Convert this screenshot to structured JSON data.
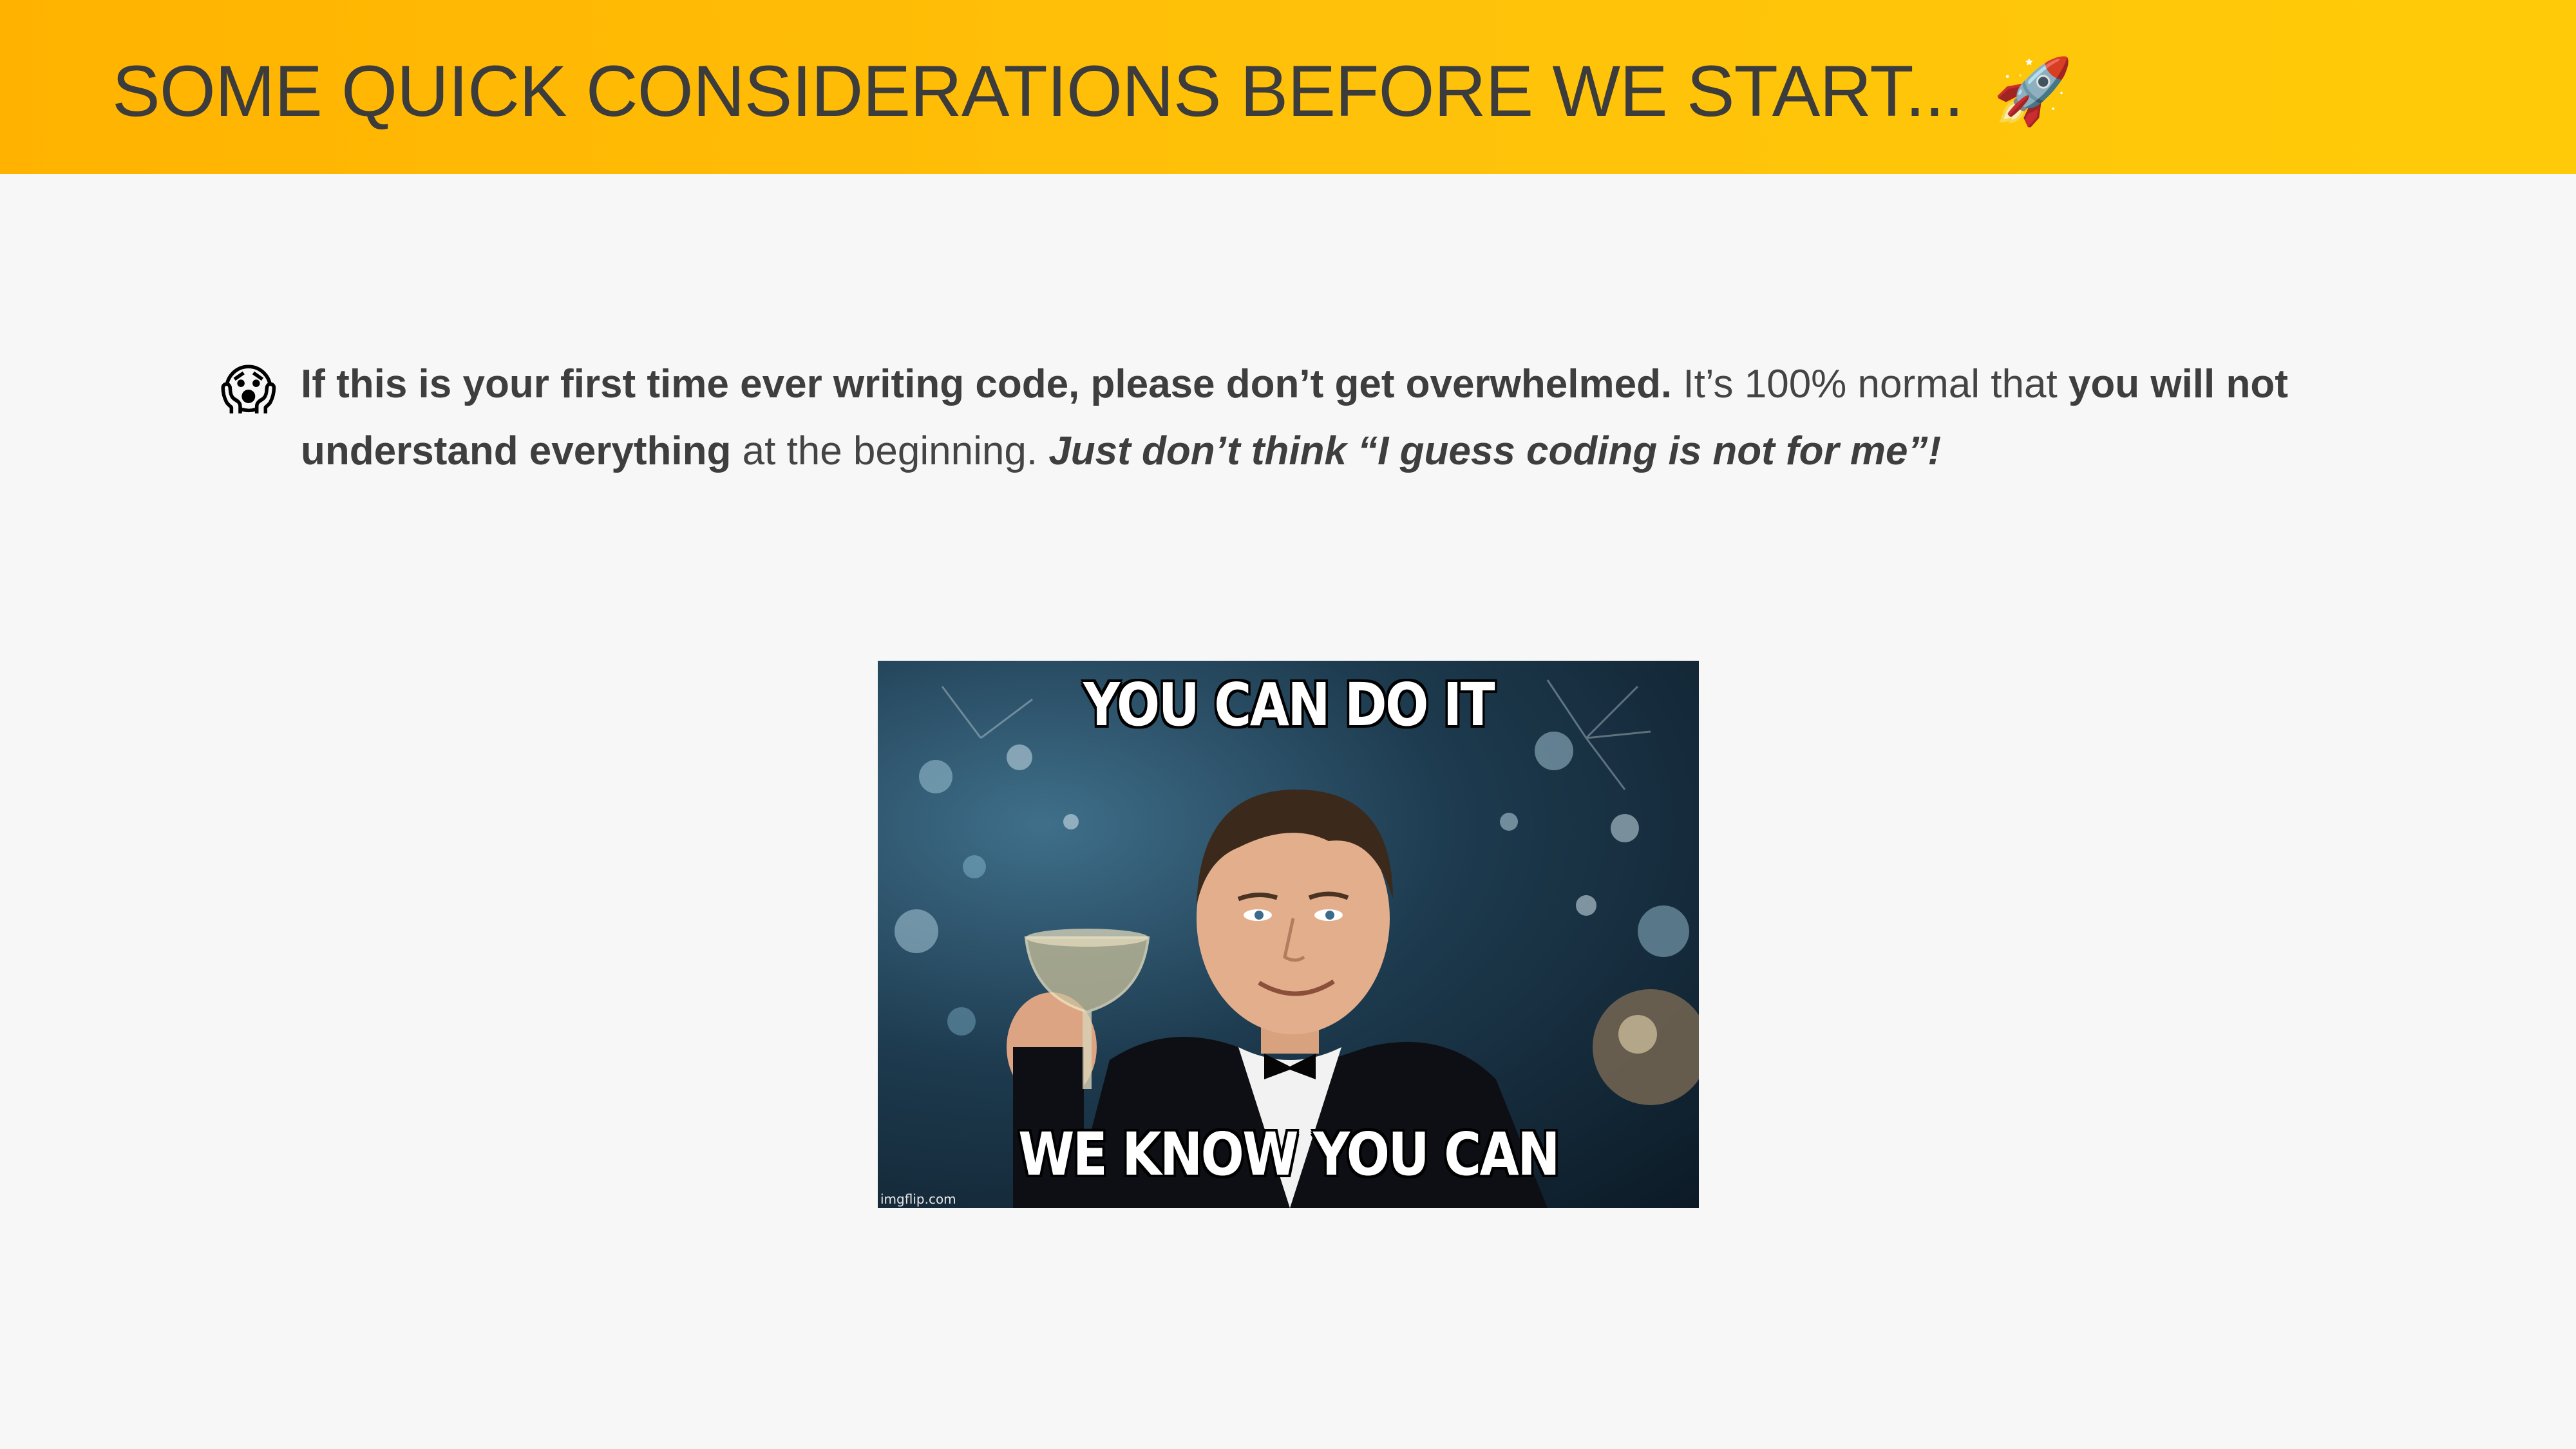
{
  "header": {
    "title": "SOME QUICK CONSIDERATIONS BEFORE WE START...",
    "title_emoji": "🚀",
    "background_color": "#ffc107",
    "title_color": "#3c3c3c"
  },
  "content": {
    "bullet": {
      "emoji": "😱",
      "segments": [
        {
          "text": "If this is your first time ever writing code, please don’t get overwhelmed.",
          "style": "bold"
        },
        {
          "text": " It’s 100% normal that ",
          "style": "normal"
        },
        {
          "text": "you will not understand everything",
          "style": "bold"
        },
        {
          "text": " at the beginning. ",
          "style": "normal"
        },
        {
          "text": "Just don’t think “I guess coding is not for me”!",
          "style": "bold-italic"
        }
      ]
    },
    "meme": {
      "top_caption": "YOU CAN DO IT",
      "bottom_caption": "WE KNOW YOU CAN",
      "watermark": "imgflip.com"
    }
  }
}
